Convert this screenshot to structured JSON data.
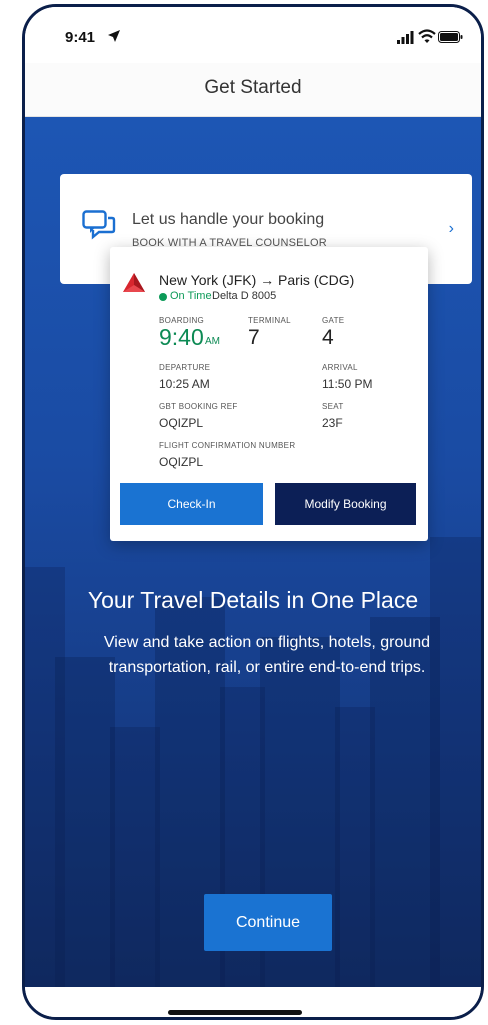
{
  "status_bar": {
    "time": "9:41"
  },
  "nav": {
    "title": "Get Started"
  },
  "counselor": {
    "title": "Let us handle your booking",
    "subtitle": "BOOK WITH A TRAVEL COUNSELOR",
    "chevron": "›"
  },
  "flight": {
    "route": "New York (JFK)  → Paris (CDG)",
    "status": "On Time",
    "flight_number": "Delta D 8005",
    "boarding_label": "BOARDING",
    "boarding_time": "9:40",
    "boarding_ampm": "AM",
    "terminal_label": "TERMINAL",
    "terminal": "7",
    "gate_label": "GATE",
    "gate": "4",
    "departure_label": "DEPARTURE",
    "departure": "10:25 AM",
    "arrival_label": "ARRIVAL",
    "arrival": "11:50 PM",
    "gbt_label": "GBT BOOKING REF",
    "gbt_ref": "OQIZPL",
    "seat_label": "SEAT",
    "seat": "23F",
    "confirmation_label": "FLIGHT CONFIRMATION NUMBER",
    "confirmation": "OQIZPL",
    "checkin_label": "Check-In",
    "modify_label": "Modify Booking"
  },
  "hero": {
    "headline": "Your Travel Details in One Place",
    "description": "View and take action on flights, hotels, ground transportation, rail, or entire end-to-end trips."
  },
  "continue_label": "Continue",
  "colors": {
    "accent": "#1a73d2",
    "navy": "#0c1f56",
    "ontime": "#0c9a58",
    "delta_red": "#d8262e"
  }
}
